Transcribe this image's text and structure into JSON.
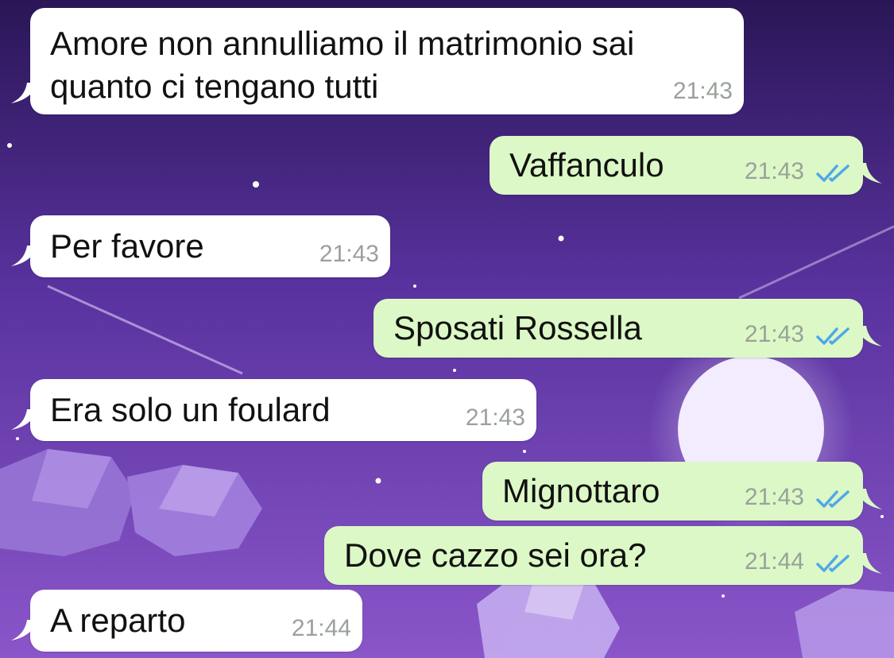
{
  "conversation": {
    "messages": [
      {
        "direction": "in",
        "lines": [
          "Amore non annulliamo il matrimonio sai",
          "quanto ci tengano tutti"
        ],
        "time": "21:43"
      },
      {
        "direction": "out",
        "lines": [
          "Vaffanculo"
        ],
        "time": "21:43",
        "status": "read"
      },
      {
        "direction": "in",
        "lines": [
          "Per favore"
        ],
        "time": "21:43"
      },
      {
        "direction": "out",
        "lines": [
          "Sposati Rossella"
        ],
        "time": "21:43",
        "status": "read"
      },
      {
        "direction": "in",
        "lines": [
          "Era solo un foulard"
        ],
        "time": "21:43"
      },
      {
        "direction": "out",
        "lines": [
          "Mignottaro"
        ],
        "time": "21:43",
        "status": "read"
      },
      {
        "direction": "out",
        "lines": [
          "Dove cazzo sei ora?"
        ],
        "time": "21:44",
        "status": "read"
      },
      {
        "direction": "in",
        "lines": [
          "A reparto"
        ],
        "time": "21:44"
      }
    ]
  },
  "colors": {
    "incoming_bubble": "#ffffff",
    "outgoing_bubble": "#dcf8c6",
    "read_ticks": "#4fa8e8",
    "wallpaper_top": "#2a1657",
    "wallpaper_bottom": "#8a56c9"
  },
  "icons": {
    "read_receipt": "double-check-icon"
  }
}
